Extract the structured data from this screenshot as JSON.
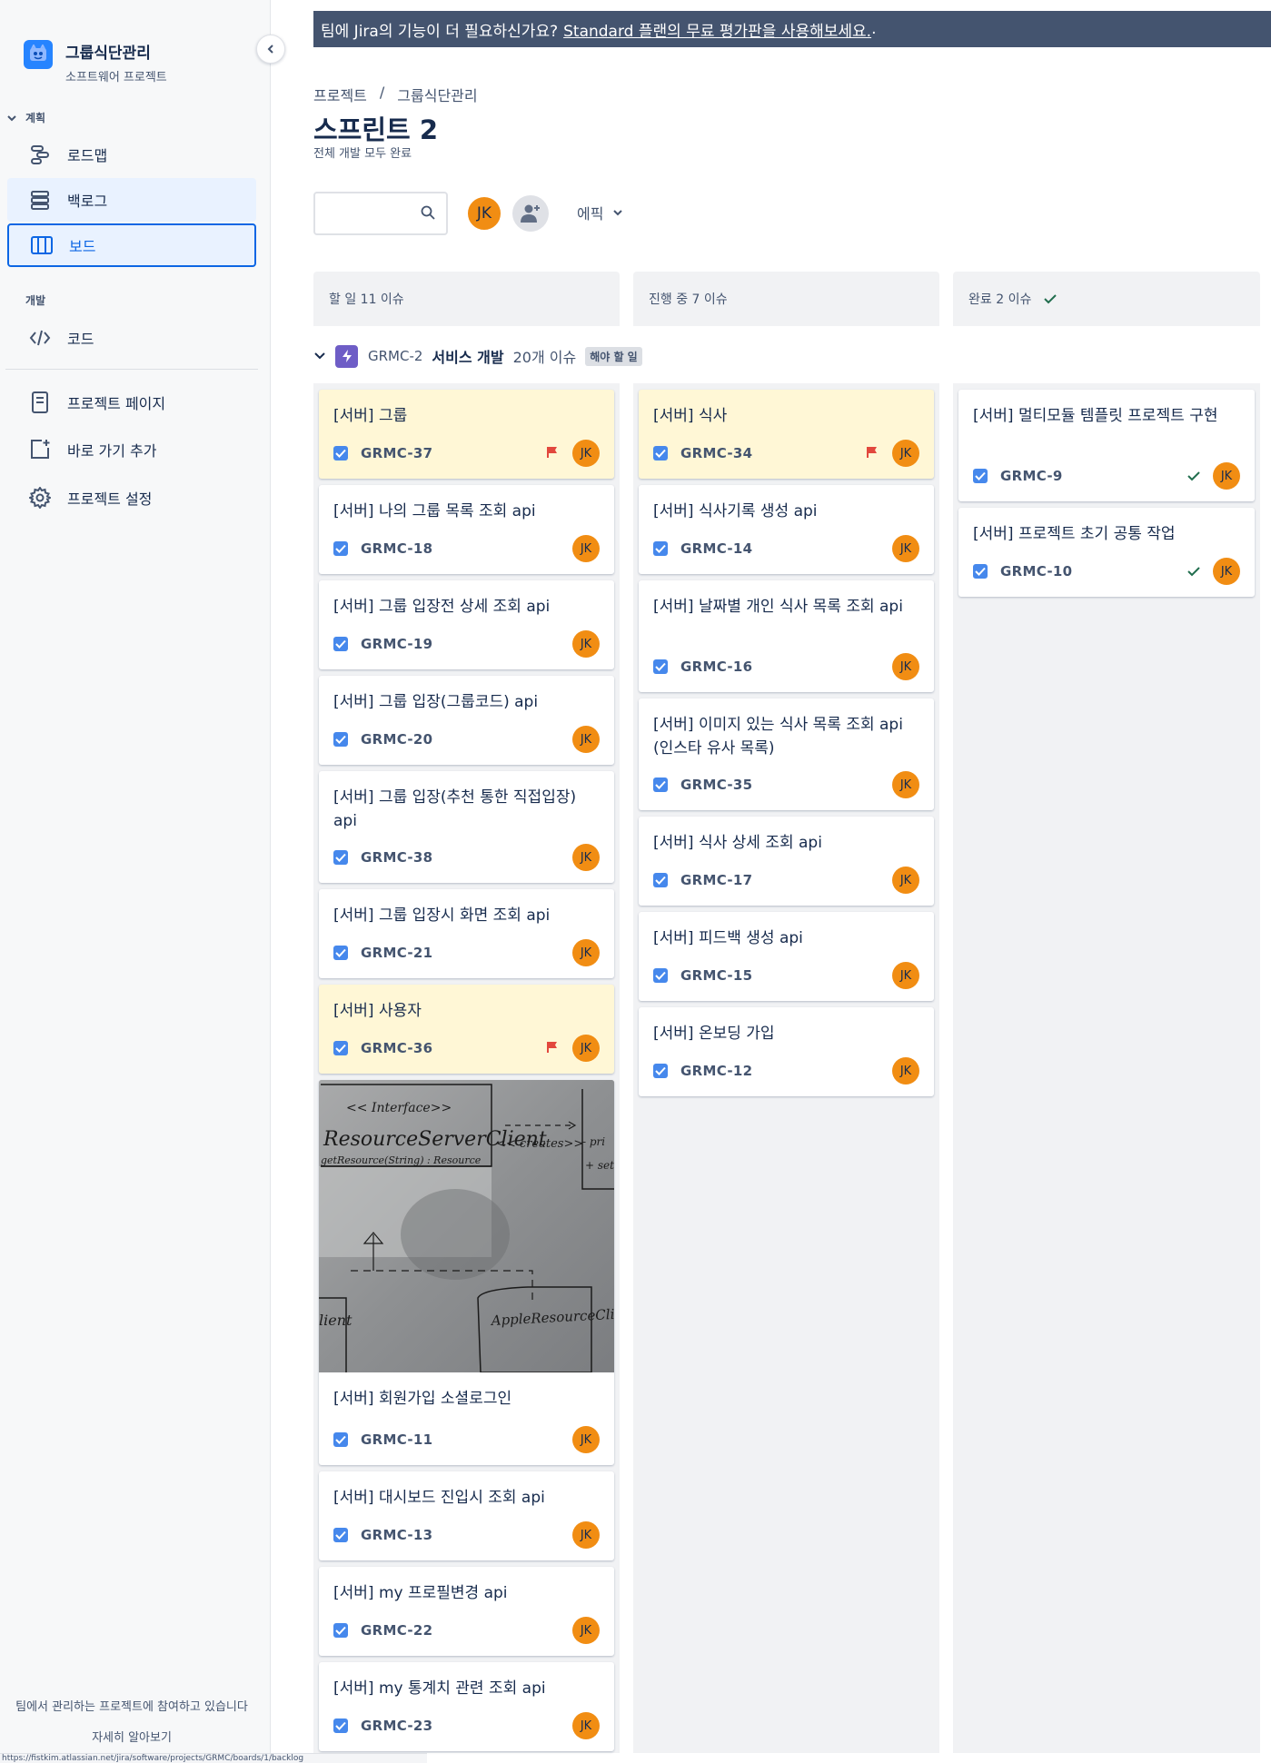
{
  "sidebar": {
    "project_name": "그룹식단관리",
    "project_type": "소프트웨어 프로젝트",
    "planning_label": "계획",
    "dev_label": "개발",
    "items": [
      {
        "label": "로드맵",
        "icon": "roadmap-icon"
      },
      {
        "label": "백로그",
        "icon": "backlog-icon"
      },
      {
        "label": "보드",
        "icon": "board-icon"
      },
      {
        "label": "코드",
        "icon": "code-icon"
      },
      {
        "label": "프로젝트 페이지",
        "icon": "page-icon"
      },
      {
        "label": "바로 가기 추가",
        "icon": "add-shortcut-icon"
      },
      {
        "label": "프로젝트 설정",
        "icon": "gear-icon"
      }
    ],
    "footer_text": "팀에서 관리하는 프로젝트에 참여하고 있습니다",
    "footer_link": "자세히 알아보기"
  },
  "banner": {
    "text": "팀에 Jira의 기능이 더 필요하신가요?",
    "link": "Standard 플랜의 무료 평가판을 사용해보세요.",
    "suffix": "."
  },
  "breadcrumb": {
    "items": [
      "프로젝트",
      "/",
      "그룹식단관리"
    ]
  },
  "page": {
    "title": "스프린트 2",
    "goal": "전체 개발 모두 완료"
  },
  "toolbar": {
    "search_placeholder": "",
    "user_initials": "JK",
    "epic_filter": "에픽"
  },
  "columns": [
    {
      "label": "할 일 11 이슈"
    },
    {
      "label": "진행 중 7 이슈"
    },
    {
      "label": "완료 2 이슈"
    }
  ],
  "epic": {
    "key": "GRMC-2",
    "name": "서비스 개발",
    "count": "20개 이슈",
    "status": "해야 할 일"
  },
  "colors": {
    "accent": "#0c66e4",
    "flag": "#e2483d",
    "avatar": "#f18d13",
    "flagged_bg": "#fff7d6",
    "epic": "#6e5dc6"
  },
  "todo": [
    {
      "title": "[서버] 그룹",
      "key": "GRMC-37",
      "flagged": true
    },
    {
      "title": "[서버] 나의 그룹 목록 조회 api",
      "key": "GRMC-18"
    },
    {
      "title": "[서버] 그룹 입장전 상세 조회 api",
      "key": "GRMC-19"
    },
    {
      "title": "[서버] 그룹 입장(그룹코드) api",
      "key": "GRMC-20"
    },
    {
      "title": "[서버] 그룹 입장(추천 통한 직접입장) api",
      "key": "GRMC-38"
    },
    {
      "title": "[서버] 그룹 입장시 화면 조회 api",
      "key": "GRMC-21"
    },
    {
      "title": "[서버] 사용자",
      "key": "GRMC-36",
      "flagged": true
    },
    {
      "title": "[서버] 회원가입 소셜로그인",
      "key": "GRMC-11",
      "image": true
    },
    {
      "title": "[서버] 대시보드 진입시 조회 api",
      "key": "GRMC-13"
    },
    {
      "title": "[서버] my 프로필변경 api",
      "key": "GRMC-22"
    },
    {
      "title": "[서버] my 통계치 관련 조회 api",
      "key": "GRMC-23"
    }
  ],
  "inprogress": [
    {
      "title": "[서버] 식사",
      "key": "GRMC-34",
      "flagged": true
    },
    {
      "title": "[서버] 식사기록 생성 api",
      "key": "GRMC-14"
    },
    {
      "title": "[서버] 날짜별 개인 식사 목록 조회 api",
      "key": "GRMC-16"
    },
    {
      "title": "[서버] 이미지 있는 식사 목록 조회 api (인스타 유사 목록)",
      "key": "GRMC-35"
    },
    {
      "title": "[서버] 식사 상세 조회 api",
      "key": "GRMC-17"
    },
    {
      "title": "[서버] 피드백 생성 api",
      "key": "GRMC-15"
    },
    {
      "title": "[서버] 온보딩 가입",
      "key": "GRMC-12"
    }
  ],
  "done": [
    {
      "title": "[서버] 멀티모듈 템플릿 프로젝트 구현",
      "key": "GRMC-9"
    },
    {
      "title": "[서버] 프로젝트 초기 공통 작업",
      "key": "GRMC-10"
    }
  ],
  "whiteboard_text": [
    "<< Interface>>",
    "ResourceServerClient",
    "getResource(String) : Resource",
    "<< creates>>",
    "AppleResourceClient",
    "lient",
    "- pri",
    "+ set"
  ],
  "status_url": "https://fistkim.atlassian.net/jira/software/projects/GRMC/boards/1/backlog"
}
